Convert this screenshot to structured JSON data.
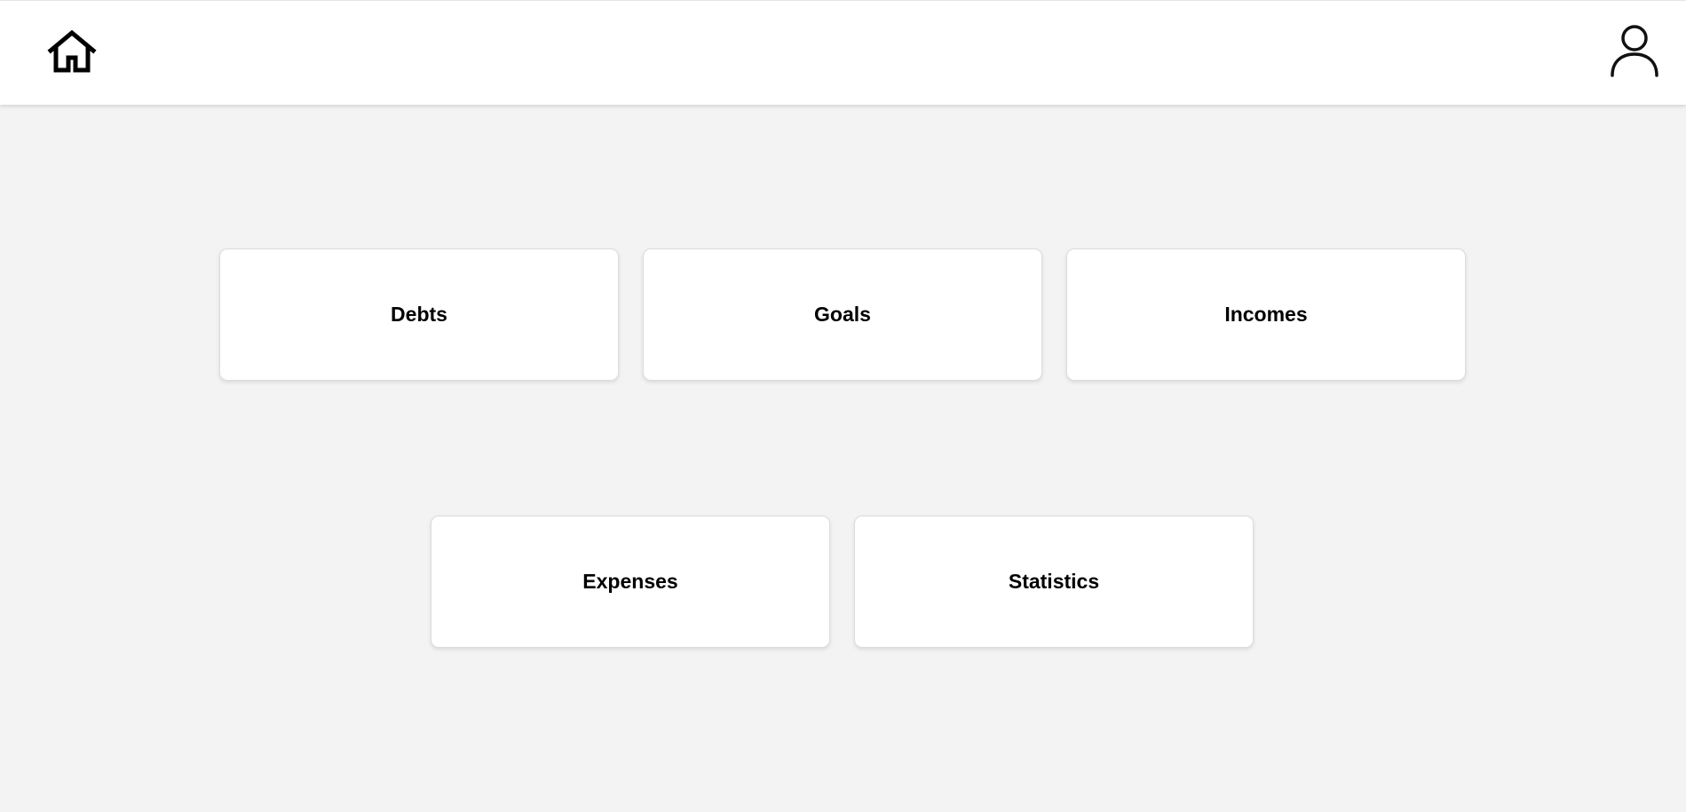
{
  "header": {
    "home_icon": "home-icon",
    "user_icon": "user-icon"
  },
  "menu": {
    "cards": [
      {
        "label": "Debts"
      },
      {
        "label": "Goals"
      },
      {
        "label": "Incomes"
      },
      {
        "label": "Expenses"
      },
      {
        "label": "Statistics"
      }
    ]
  },
  "colors": {
    "background": "#f3f3f3",
    "card": "#ffffff",
    "text": "#000000"
  }
}
